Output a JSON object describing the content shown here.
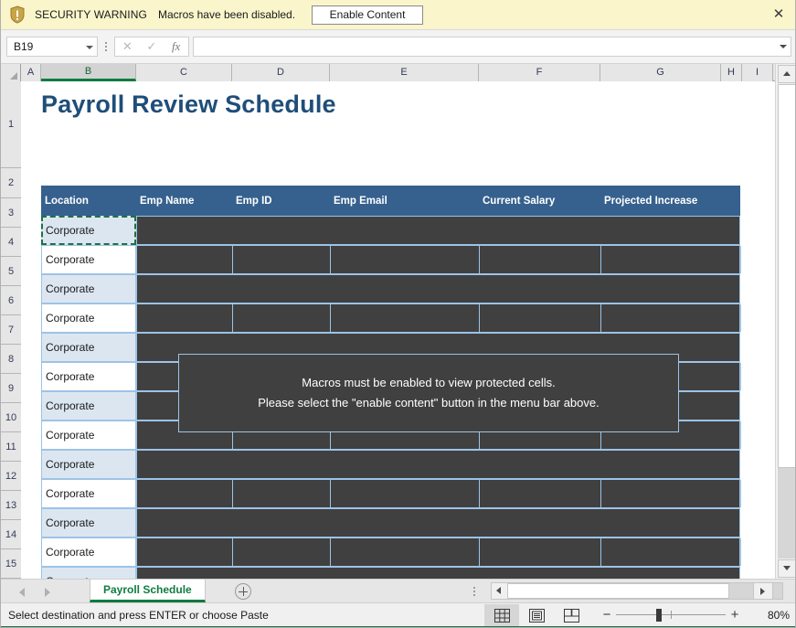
{
  "security_bar": {
    "icon": "shield-warning-icon",
    "title": "SECURITY WARNING",
    "message": "Macros have been disabled.",
    "button_label": "Enable Content",
    "close_label": "✕",
    "background": "#faf5cb"
  },
  "formula_bar": {
    "name_box_value": "B19",
    "cancel_icon": "✕",
    "confirm_icon": "✓",
    "function_icon": "fx",
    "formula_value": "",
    "formula_placeholder": ""
  },
  "grid": {
    "columns": [
      "A",
      "B",
      "C",
      "D",
      "E",
      "F",
      "G",
      "H",
      "I"
    ],
    "selected_column": "B",
    "rows": [
      "1",
      "2",
      "3",
      "4",
      "5",
      "6",
      "7",
      "8",
      "9",
      "10",
      "11",
      "12",
      "13",
      "14",
      "15"
    ],
    "title": "Payroll Review Schedule",
    "title_color": "#1f4e79",
    "table_header_color": "#36618e",
    "protected_cell_color": "#404040",
    "band_color": "#dce6f1",
    "border_color": "#9dc3e6",
    "headers": [
      "Location",
      "Emp Name",
      "Emp ID",
      "Emp Email",
      "Current Salary",
      "Projected Increase"
    ],
    "location_values": [
      "Corporate",
      "Corporate",
      "Corporate",
      "Corporate",
      "Corporate",
      "Corporate",
      "Corporate",
      "Corporate",
      "Corporate",
      "Corporate",
      "Corporate",
      "Corporate",
      "Corporate"
    ],
    "macro_message_line1": "Macros must be enabled to view protected cells.",
    "macro_message_line2": "Please select the \"enable content\" button in the menu bar above."
  },
  "tabs": {
    "sheets": [
      "Payroll Schedule"
    ],
    "active_sheet": "Payroll Schedule",
    "add_sheet_label": "+",
    "sheet_tab_color": "#107c41"
  },
  "status_bar": {
    "message": "Select destination and press ENTER or choose Paste",
    "view_normal_icon": "normal-view-icon",
    "view_page_layout_icon": "page-layout-view-icon",
    "view_page_break_icon": "page-break-view-icon",
    "zoom_out_label": "−",
    "zoom_in_label": "+",
    "zoom_level": "80%"
  }
}
